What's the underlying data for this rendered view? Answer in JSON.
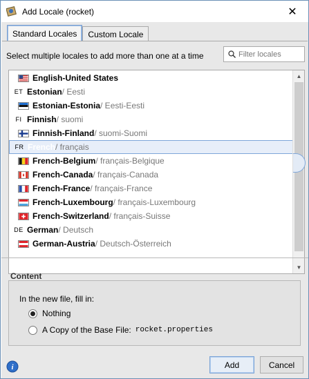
{
  "window": {
    "title": "Add Locale (rocket)",
    "close_glyph": "✕"
  },
  "tabs": [
    {
      "label": "Standard Locales",
      "active": true
    },
    {
      "label": "Custom Locale",
      "active": false
    }
  ],
  "hint": "Select multiple locales to add more than one at a time",
  "filter": {
    "placeholder": "Filter locales"
  },
  "locales": [
    {
      "code": "",
      "flag": "us",
      "name": "English-United States",
      "native": ""
    },
    {
      "code": "ET",
      "flag": "",
      "name": "Estonian",
      "native": " / Eesti"
    },
    {
      "code": "",
      "flag": "ee",
      "name": "Estonian-Estonia",
      "native": " / Eesti-Eesti"
    },
    {
      "code": "FI",
      "flag": "",
      "name": "Finnish",
      "native": " / suomi"
    },
    {
      "code": "",
      "flag": "fi",
      "name": "Finnish-Finland",
      "native": " / suomi-Suomi"
    },
    {
      "code": "FR",
      "flag": "",
      "name": "French",
      "native": " / français",
      "selected": true
    },
    {
      "code": "",
      "flag": "be",
      "name": "French-Belgium",
      "native": " / français-Belgique"
    },
    {
      "code": "",
      "flag": "ca",
      "name": "French-Canada",
      "native": " / français-Canada"
    },
    {
      "code": "",
      "flag": "fr",
      "name": "French-France",
      "native": " / français-France"
    },
    {
      "code": "",
      "flag": "lu",
      "name": "French-Luxembourg",
      "native": " / français-Luxembourg"
    },
    {
      "code": "",
      "flag": "ch",
      "name": "French-Switzerland",
      "native": " / français-Suisse"
    },
    {
      "code": "DE",
      "flag": "",
      "name": "German",
      "native": " / Deutsch"
    },
    {
      "code": "",
      "flag": "at",
      "name": "German-Austria",
      "native": " / Deutsch-Österreich"
    }
  ],
  "content": {
    "title": "Content",
    "fill_label": "In the new file, fill in:",
    "option_nothing": "Nothing",
    "option_copy": "A Copy of the Base File:",
    "base_file": "rocket.properties"
  },
  "buttons": {
    "add": "Add",
    "cancel": "Cancel"
  },
  "colors": {
    "accent": "#7ea6d9",
    "selected_bg": "#e7eef9"
  }
}
